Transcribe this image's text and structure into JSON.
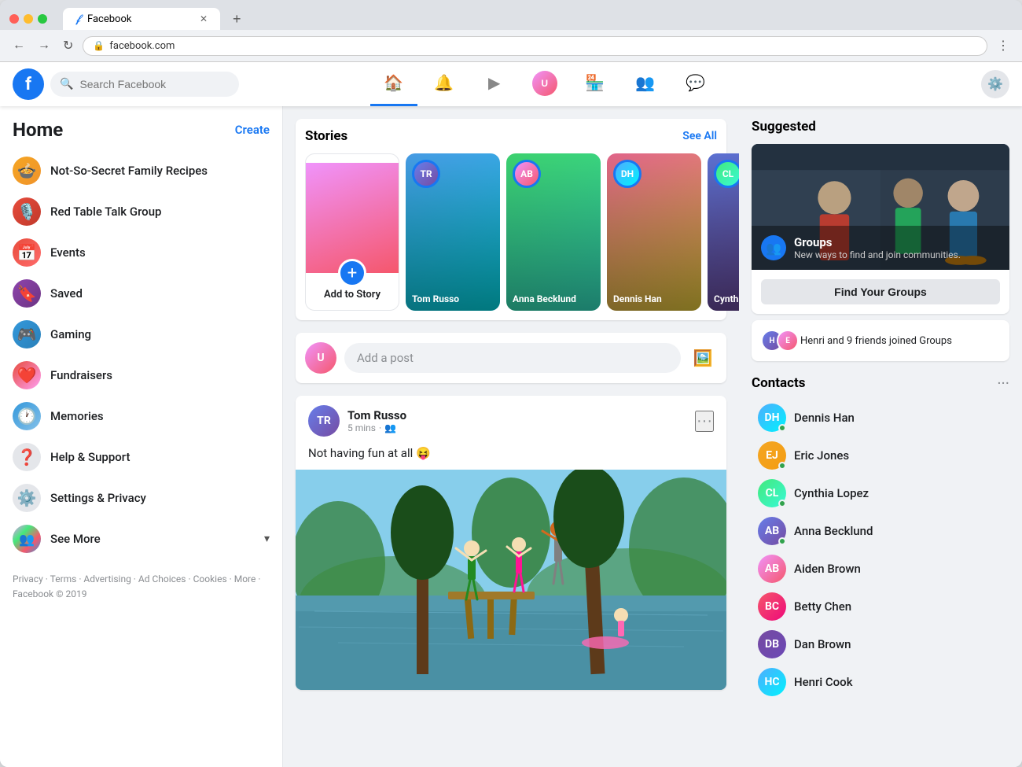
{
  "browser": {
    "url": "facebook.com",
    "tab_title": "Facebook",
    "dot_colors": [
      "#ff5f57",
      "#febc2e",
      "#28c840"
    ]
  },
  "nav": {
    "search_placeholder": "Search Facebook",
    "icons": [
      "🏠",
      "🔔",
      "▶",
      "👤",
      "🏪",
      "👥",
      "💬"
    ],
    "active_index": 0,
    "settings_icon": "⚙️"
  },
  "sidebar": {
    "title": "Home",
    "create_label": "Create",
    "items": [
      {
        "label": "Not-So-Secret Family Recipes",
        "icon": "🍲",
        "type": "group"
      },
      {
        "label": "Red Table Talk Group",
        "icon": "🎙️",
        "type": "group"
      },
      {
        "label": "Events",
        "icon": "📅",
        "type": "menu"
      },
      {
        "label": "Saved",
        "icon": "🔖",
        "type": "menu"
      },
      {
        "label": "Gaming",
        "icon": "🎮",
        "type": "menu"
      },
      {
        "label": "Fundraisers",
        "icon": "❤️",
        "type": "menu"
      },
      {
        "label": "Memories",
        "icon": "🕐",
        "type": "menu"
      },
      {
        "label": "Help & Support",
        "icon": "❓",
        "type": "menu"
      },
      {
        "label": "Settings & Privacy",
        "icon": "⚙️",
        "type": "menu"
      },
      {
        "label": "See More",
        "icon": "👥",
        "type": "expand"
      }
    ],
    "footer": "Privacy · Terms · Advertising · Ad Choices · Cookies · More · Facebook © 2019"
  },
  "stories": {
    "title": "Stories",
    "see_all": "See All",
    "add_label": "Add to Story",
    "items": [
      {
        "name": "Tom Russo",
        "color1": "#4facfe",
        "color2": "#00f2fe"
      },
      {
        "name": "Anna Becklund",
        "color1": "#43e97b",
        "color2": "#38f9d7"
      },
      {
        "name": "Dennis Han",
        "color1": "#fa709a",
        "color2": "#fee140"
      },
      {
        "name": "Cynthia Lopez",
        "color1": "#667eea",
        "color2": "#764ba2"
      }
    ]
  },
  "post_box": {
    "placeholder": "Add a post"
  },
  "post": {
    "username": "Tom Russo",
    "time": "5 mins",
    "privacy": "friends",
    "text": "Not having fun at all 😝"
  },
  "suggested": {
    "title": "Suggested",
    "groups_title": "Groups",
    "groups_subtitle": "New ways to find and join communities.",
    "find_groups_btn": "Find Your Groups",
    "joined_text": "Henri and 9 friends joined Groups"
  },
  "contacts": {
    "title": "Contacts",
    "items": [
      {
        "name": "Dennis Han",
        "color": "#4facfe",
        "initials": "DH",
        "online": true
      },
      {
        "name": "Eric Jones",
        "color": "#f5a623",
        "initials": "EJ",
        "online": true
      },
      {
        "name": "Cynthia Lopez",
        "color": "#43e97b",
        "initials": "CL",
        "online": true
      },
      {
        "name": "Anna Becklund",
        "color": "#667eea",
        "initials": "AB",
        "online": true
      },
      {
        "name": "Aiden Brown",
        "color": "#f093fb",
        "initials": "AB2",
        "online": false
      },
      {
        "name": "Betty Chen",
        "color": "#f5576c",
        "initials": "BC",
        "online": false
      },
      {
        "name": "Dan Brown",
        "color": "#764ba2",
        "initials": "DB",
        "online": false
      },
      {
        "name": "Henri Cook",
        "color": "#4facfe",
        "initials": "HC",
        "online": false
      }
    ]
  }
}
